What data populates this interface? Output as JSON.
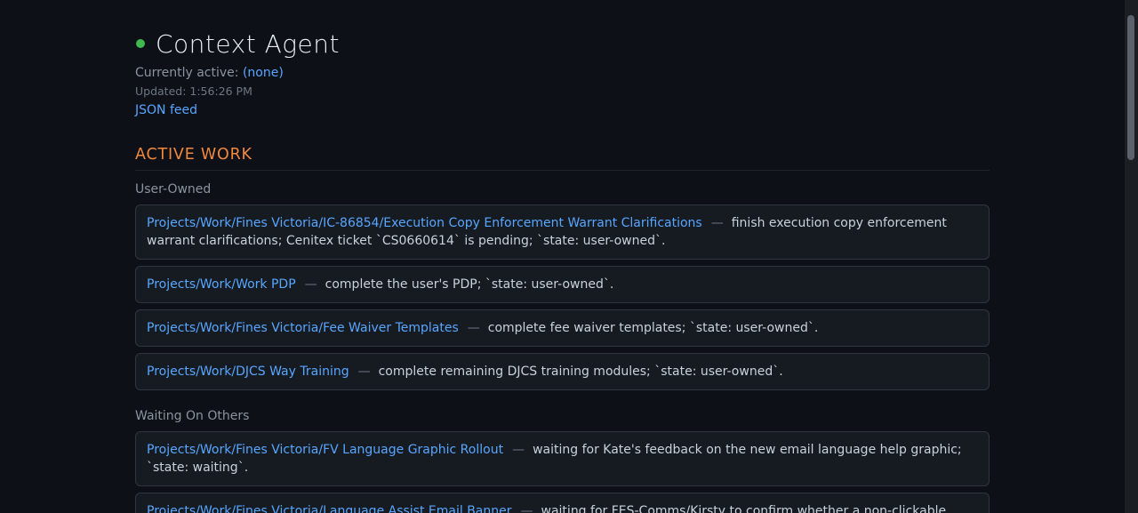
{
  "header": {
    "title": "Context Agent",
    "active_label": "Currently active:",
    "active_value": "(none)",
    "updated": "Updated: 1:56:26 PM",
    "json_link": "JSON feed",
    "status_color": "#3fb950"
  },
  "section": {
    "heading": "ACTIVE WORK",
    "groups": [
      {
        "label": "User-Owned",
        "items": [
          {
            "path": "Projects/Work/Fines Victoria/IC-86854/Execution Copy Enforcement Warrant Clarifications",
            "separator": "—",
            "text": "finish execution copy enforcement warrant clarifications; Cenitex ticket `CS0660614` is pending; `state: user-owned`."
          },
          {
            "path": "Projects/Work/Work PDP",
            "separator": "—",
            "text": "complete the user's PDP; `state: user-owned`."
          },
          {
            "path": "Projects/Work/Fines Victoria/Fee Waiver Templates",
            "separator": "—",
            "text": "complete fee waiver templates; `state: user-owned`."
          },
          {
            "path": "Projects/Work/DJCS Way Training",
            "separator": "—",
            "text": "complete remaining DJCS training modules; `state: user-owned`."
          }
        ]
      },
      {
        "label": "Waiting On Others",
        "items": [
          {
            "path": "Projects/Work/Fines Victoria/FV Language Graphic Rollout",
            "separator": "—",
            "text": "waiting for Kate's feedback on the new email language help graphic; `state: waiting`."
          },
          {
            "path": "Projects/Work/Fines Victoria/Language Assist Email Banner",
            "separator": "—",
            "text": "waiting for FES-Comms/Kirsty to confirm whether a non-clickable"
          }
        ]
      }
    ]
  },
  "colors": {
    "background": "#0d1117",
    "card": "#161b22",
    "link": "#58a6ff",
    "heading": "#f0883e"
  }
}
